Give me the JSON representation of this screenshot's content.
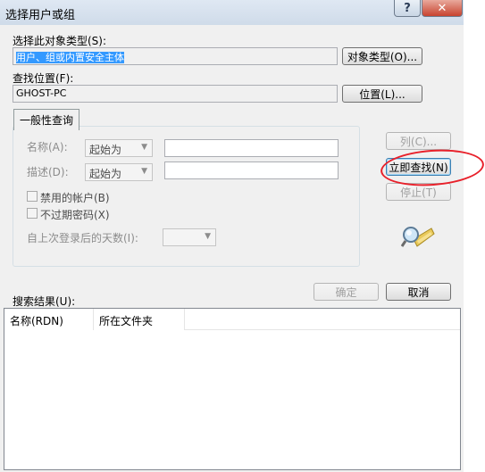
{
  "window": {
    "title": "选择用户或组",
    "help": "?",
    "close": "✕"
  },
  "object_type": {
    "label": "选择此对象类型(S):",
    "value": "用户、组或内置安全主体",
    "button": "对象类型(O)..."
  },
  "location": {
    "label": "查找位置(F):",
    "value": "GHOST-PC",
    "button": "位置(L)..."
  },
  "query": {
    "tab": "一般性查询",
    "name_label": "名称(A):",
    "name_op": "起始为",
    "desc_label": "描述(D):",
    "desc_op": "起始为",
    "disabled_accounts": "禁用的帐户(B)",
    "non_expiring": "不过期密码(X)",
    "days_label": "自上次登录后的天数(I):",
    "days_value": ""
  },
  "side_buttons": {
    "columns": "列(C)...",
    "find_now": "立即查找(N)",
    "stop": "停止(T)"
  },
  "actions": {
    "ok": "确定",
    "cancel": "取消"
  },
  "results": {
    "label": "搜索结果(U):",
    "columns": [
      "名称(RDN)",
      "所在文件夹"
    ]
  },
  "colors": {
    "annotation": "#e8202a",
    "selection": "#3399ff"
  },
  "icons": {
    "search": "search-flashlight-icon",
    "dropdown": "chevron-down-icon"
  }
}
